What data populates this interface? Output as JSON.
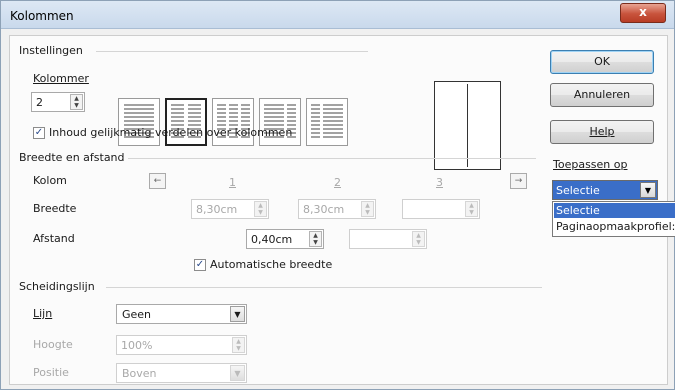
{
  "window": {
    "title": "Kolommen",
    "close_glyph": "x"
  },
  "settings": {
    "section_label": "Instellingen",
    "columns_label": "Kolommer",
    "columns_value": "2",
    "distribute_checkbox_label": "Inhoud gelijkmatig verdelen over kolommen",
    "distribute_checked": true
  },
  "width_spacing": {
    "section_label": "Breedte en afstand",
    "column_label": "Kolom",
    "width_label": "Breedte",
    "spacing_label": "Afstand",
    "column_numbers": [
      "1",
      "2",
      "3"
    ],
    "widths": [
      "8,30cm",
      "8,30cm",
      ""
    ],
    "spacings": [
      "0,40cm",
      ""
    ],
    "auto_width_label": "Automatische breedte",
    "auto_width_checked": true,
    "prev_glyph": "←",
    "next_glyph": "→"
  },
  "separator": {
    "section_label": "Scheidingslijn",
    "line_label": "Lijn",
    "line_value": "Geen",
    "height_label": "Hoogte",
    "height_value": "100%",
    "position_label": "Positie",
    "position_value": "Boven"
  },
  "buttons": {
    "ok": "OK",
    "cancel": "Annuleren",
    "help": "Help"
  },
  "apply_to": {
    "label": "Toepassen op",
    "selected": "Selectie",
    "options": [
      "Selectie",
      "Paginaopmaakprofiel:Standaard"
    ]
  },
  "icons": {
    "spin_arrows": "spin-arrows-icon",
    "dropdown": "chevron-down-icon",
    "checkmark": "checkmark-icon"
  },
  "colors": {
    "selection": "#3a6ec8",
    "close": "#c8533c"
  }
}
